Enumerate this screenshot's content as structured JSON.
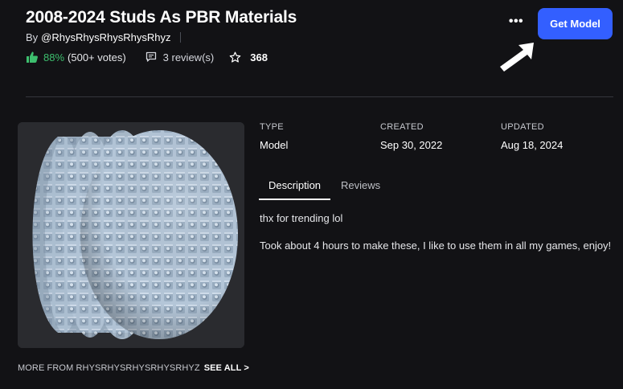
{
  "header": {
    "title": "2008-2024 Studs As PBR Materials",
    "by_label": "By",
    "creator": "@RhysRhysRhysRhysRhyz",
    "more_label": "•••",
    "get_model_label": "Get Model"
  },
  "stats": {
    "rating_percent": "88%",
    "votes": "(500+ votes)",
    "reviews": "3 review(s)",
    "favorites": "368"
  },
  "details": {
    "type_label": "TYPE",
    "type_value": "Model",
    "created_label": "CREATED",
    "created_value": "Sep 30, 2022",
    "updated_label": "UPDATED",
    "updated_value": "Aug 18, 2024"
  },
  "tabs": [
    {
      "label": "Description",
      "active": true
    },
    {
      "label": "Reviews",
      "active": false
    }
  ],
  "description": {
    "line1": "thx for trending lol",
    "line2": "Took about 4 hours to make these, I like to use them in all my games, enjoy!"
  },
  "footer": {
    "more_from": "MORE FROM RHYSRHYSRHYSRHYSRHYZ",
    "see_all": "SEE ALL >"
  },
  "colors": {
    "background": "#121215",
    "accent_button": "#335fff",
    "rating_green": "#3dbf6e"
  },
  "icons": [
    "thumbs-up-icon",
    "review-icon",
    "star-icon",
    "more-icon",
    "arrow-icon"
  ]
}
